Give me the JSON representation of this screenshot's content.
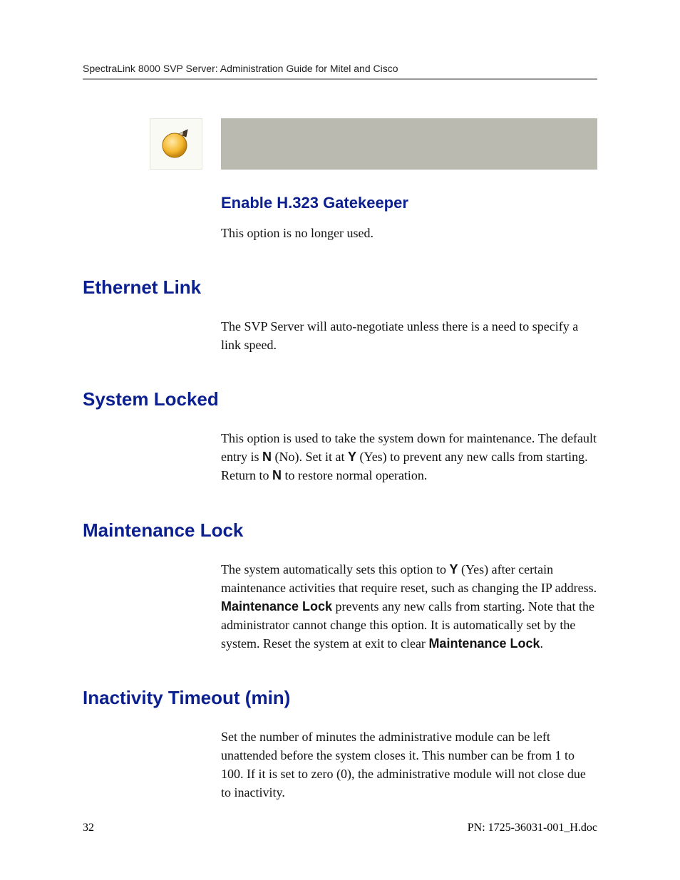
{
  "header": {
    "running_title": "SpectraLink 8000 SVP Server: Administration Guide for Mitel and Cisco"
  },
  "sections": {
    "gatekeeper": {
      "heading": "Enable H.323 Gatekeeper",
      "body": "This option is no longer used."
    },
    "ethernet": {
      "heading": "Ethernet Link",
      "body": "The SVP Server will auto-negotiate unless there is a need to specify a link speed."
    },
    "locked": {
      "heading": "System Locked",
      "body_a": "This option is used to take the system down for maintenance. The default entry is ",
      "b1": "N",
      "body_b": " (No). Set it at ",
      "b2": "Y",
      "body_c": " (Yes) to prevent any new calls from starting. Return to ",
      "b3": "N",
      "body_d": " to restore normal operation."
    },
    "maint": {
      "heading": "Maintenance Lock",
      "body_a": "The system automatically sets this option to ",
      "b1": "Y",
      "body_b": " (Yes) after certain maintenance activities that require reset, such as changing the IP address. ",
      "b2": "Maintenance Lock",
      "body_c": " prevents any new calls from starting. Note that the administrator cannot change this option. It is automatically set by the system. Reset the system at exit to clear ",
      "b3": "Maintenance Lock",
      "body_d": "."
    },
    "timeout": {
      "heading": "Inactivity Timeout (min)",
      "body": "Set the number of minutes the administrative module can be left unattended before the system closes it. This number can be from 1 to 100. If it is set to zero (0), the administrative module will not close due to inactivity."
    }
  },
  "footer": {
    "page": "32",
    "pn": "PN: 1725-36031-001_H.doc"
  }
}
